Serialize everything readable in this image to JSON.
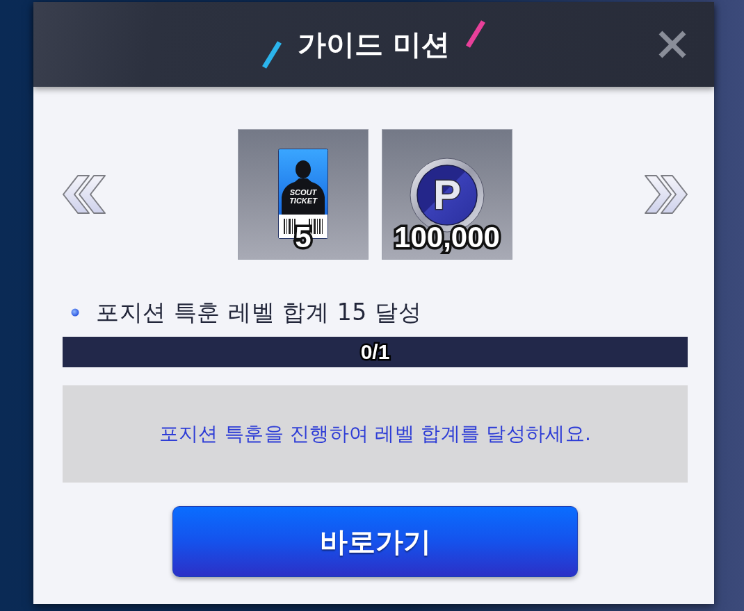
{
  "dialog": {
    "title": "가이드 미션"
  },
  "rewards": [
    {
      "kind": "ticket",
      "label": "SCOUT TICKET",
      "amount": "5"
    },
    {
      "kind": "points",
      "symbol": "P",
      "amount": "100,000"
    }
  ],
  "mission": {
    "text": "포지션 특훈 레벨 합계 15 달성",
    "progress": {
      "reading": "0/1"
    }
  },
  "hint": "포지션 특훈을 진행하여 레벨 합계를 달성하세요.",
  "action": {
    "label": "바로가기"
  }
}
